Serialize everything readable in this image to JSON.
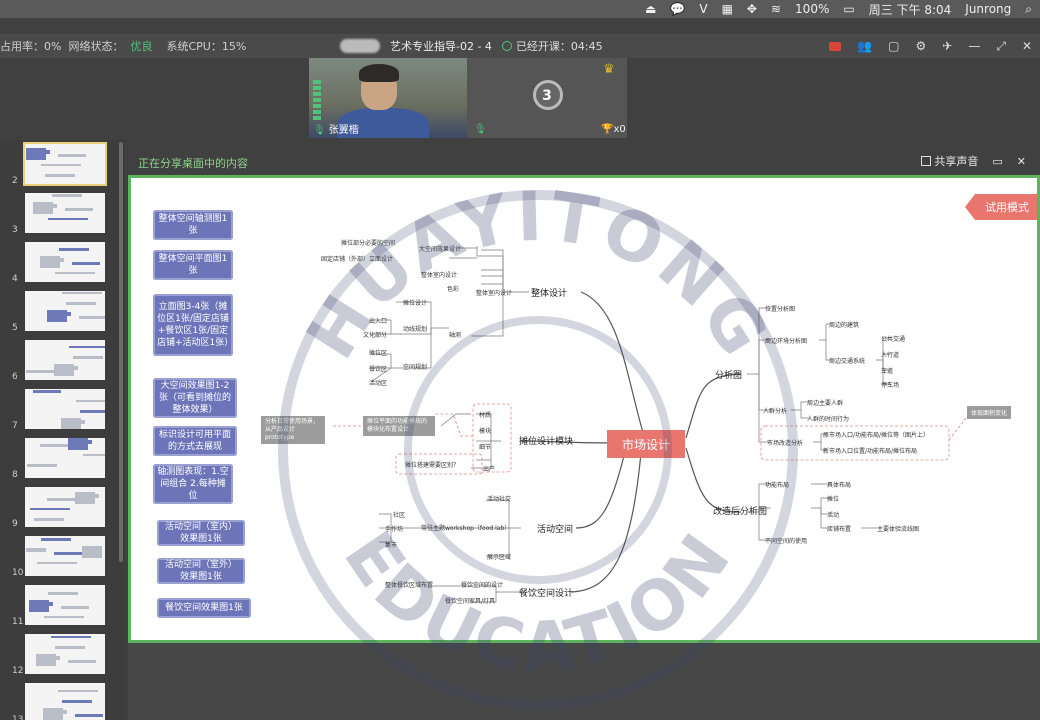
{
  "menubar": {
    "battery": "100%",
    "datetime": "周三 下午 8:04",
    "user": "Junrong"
  },
  "toolbar": {
    "cpu_label": "占用率：0%",
    "net_label": "网络状态：",
    "net_value": "优良",
    "sys_cpu": "系统CPU：15%",
    "course_title": "艺术专业指导-02 - 4",
    "elapsed": "已经开课：04:45"
  },
  "video": {
    "teacher_name": "张翼楷",
    "count": "3",
    "trophy_count": "x0"
  },
  "sidebar": {
    "numbers": [
      "2",
      "3",
      "4",
      "5",
      "6",
      "7",
      "8",
      "9",
      "10",
      "11",
      "12",
      "13"
    ]
  },
  "share": {
    "label": "正在分享桌面中的内容",
    "sound": "共享声音"
  },
  "slide": {
    "trial": "试用模式",
    "left_buttons": [
      "整体空间轴测图1张",
      "整体空间平面图1张",
      "立面图3-4张（摊位区1张/固定店铺+餐饮区1张/固定店铺+活动区1张）",
      "大空间效果图1-2张（可看到摊位的整体效果）",
      "标识设计可用平面的方式去展现",
      "轴测图表现：1.空间组合 2.每种摊位",
      "活动空间（室内）效果图1张",
      "活动空间（室外）效果图1张",
      "餐饮空间效果图1张"
    ],
    "center": "市场设计",
    "branches": {
      "b1": "整体设计",
      "b2": "摊位设计模块",
      "b3": "活动空间",
      "b4": "餐饮空间设计",
      "b5": "分析图",
      "b6": "改造后分析图"
    },
    "leaves": {
      "l1": "摊位部分必要的空间",
      "l2": "大空间效果设计",
      "l3": "固定店铺（外部）立面设计",
      "l4": "整体室内设计",
      "l5": "色彩",
      "l6": "整体室内设计",
      "l7": "摊位设计",
      "l8": "出入口",
      "l9": "动线规划",
      "l10": "文化部分",
      "l11": "摊位区",
      "l12": "餐饮区",
      "l13": "活动区",
      "l14": "空间规划",
      "l15": "轴测",
      "l16": "材质",
      "l17": "模块",
      "l18": "细节",
      "l19": "摊位搭建需要区别？",
      "l20": "出产",
      "l21": "活动社交",
      "l22": "社区",
      "l23": "展示区域",
      "l24": "集市",
      "l25": "手作坊",
      "l26": "常驻主题workshop（food lab）",
      "l27": "餐饮空间的设计",
      "l28": "餐饮空间家具/灯具",
      "l29": "整体餐饮区域布置",
      "r1": "位置分析图",
      "r2": "周边环境分析图",
      "r3": "周边的建筑",
      "r4": "周边交通系统",
      "r5": "公共交通",
      "r6": "人行道",
      "r7": "车道",
      "r8": "停车场",
      "r9": "人群分析",
      "r10": "周边主要人群",
      "r11": "人群的时间行为",
      "r12": "市场改造分析",
      "r13": "原市场入口/功能布局/摊位等（图片上）",
      "r14": "新市场入口位置/功能布局/摊位布局",
      "r15": "体现面积变化",
      "r16": "功能布局",
      "r17": "具体布局",
      "r18": "摊位",
      "r19": "活动",
      "r20": "店铺布置",
      "r21": "主要体验流线图",
      "r22": "不同空间的使用",
      "g1": "分析日常使用场景，从产品设计prototype",
      "g2": "摊位平面的功能模块的模块化布置设计"
    }
  },
  "watermark": {
    "line1": "HUAYITONG",
    "line2": "EDUCATION"
  }
}
